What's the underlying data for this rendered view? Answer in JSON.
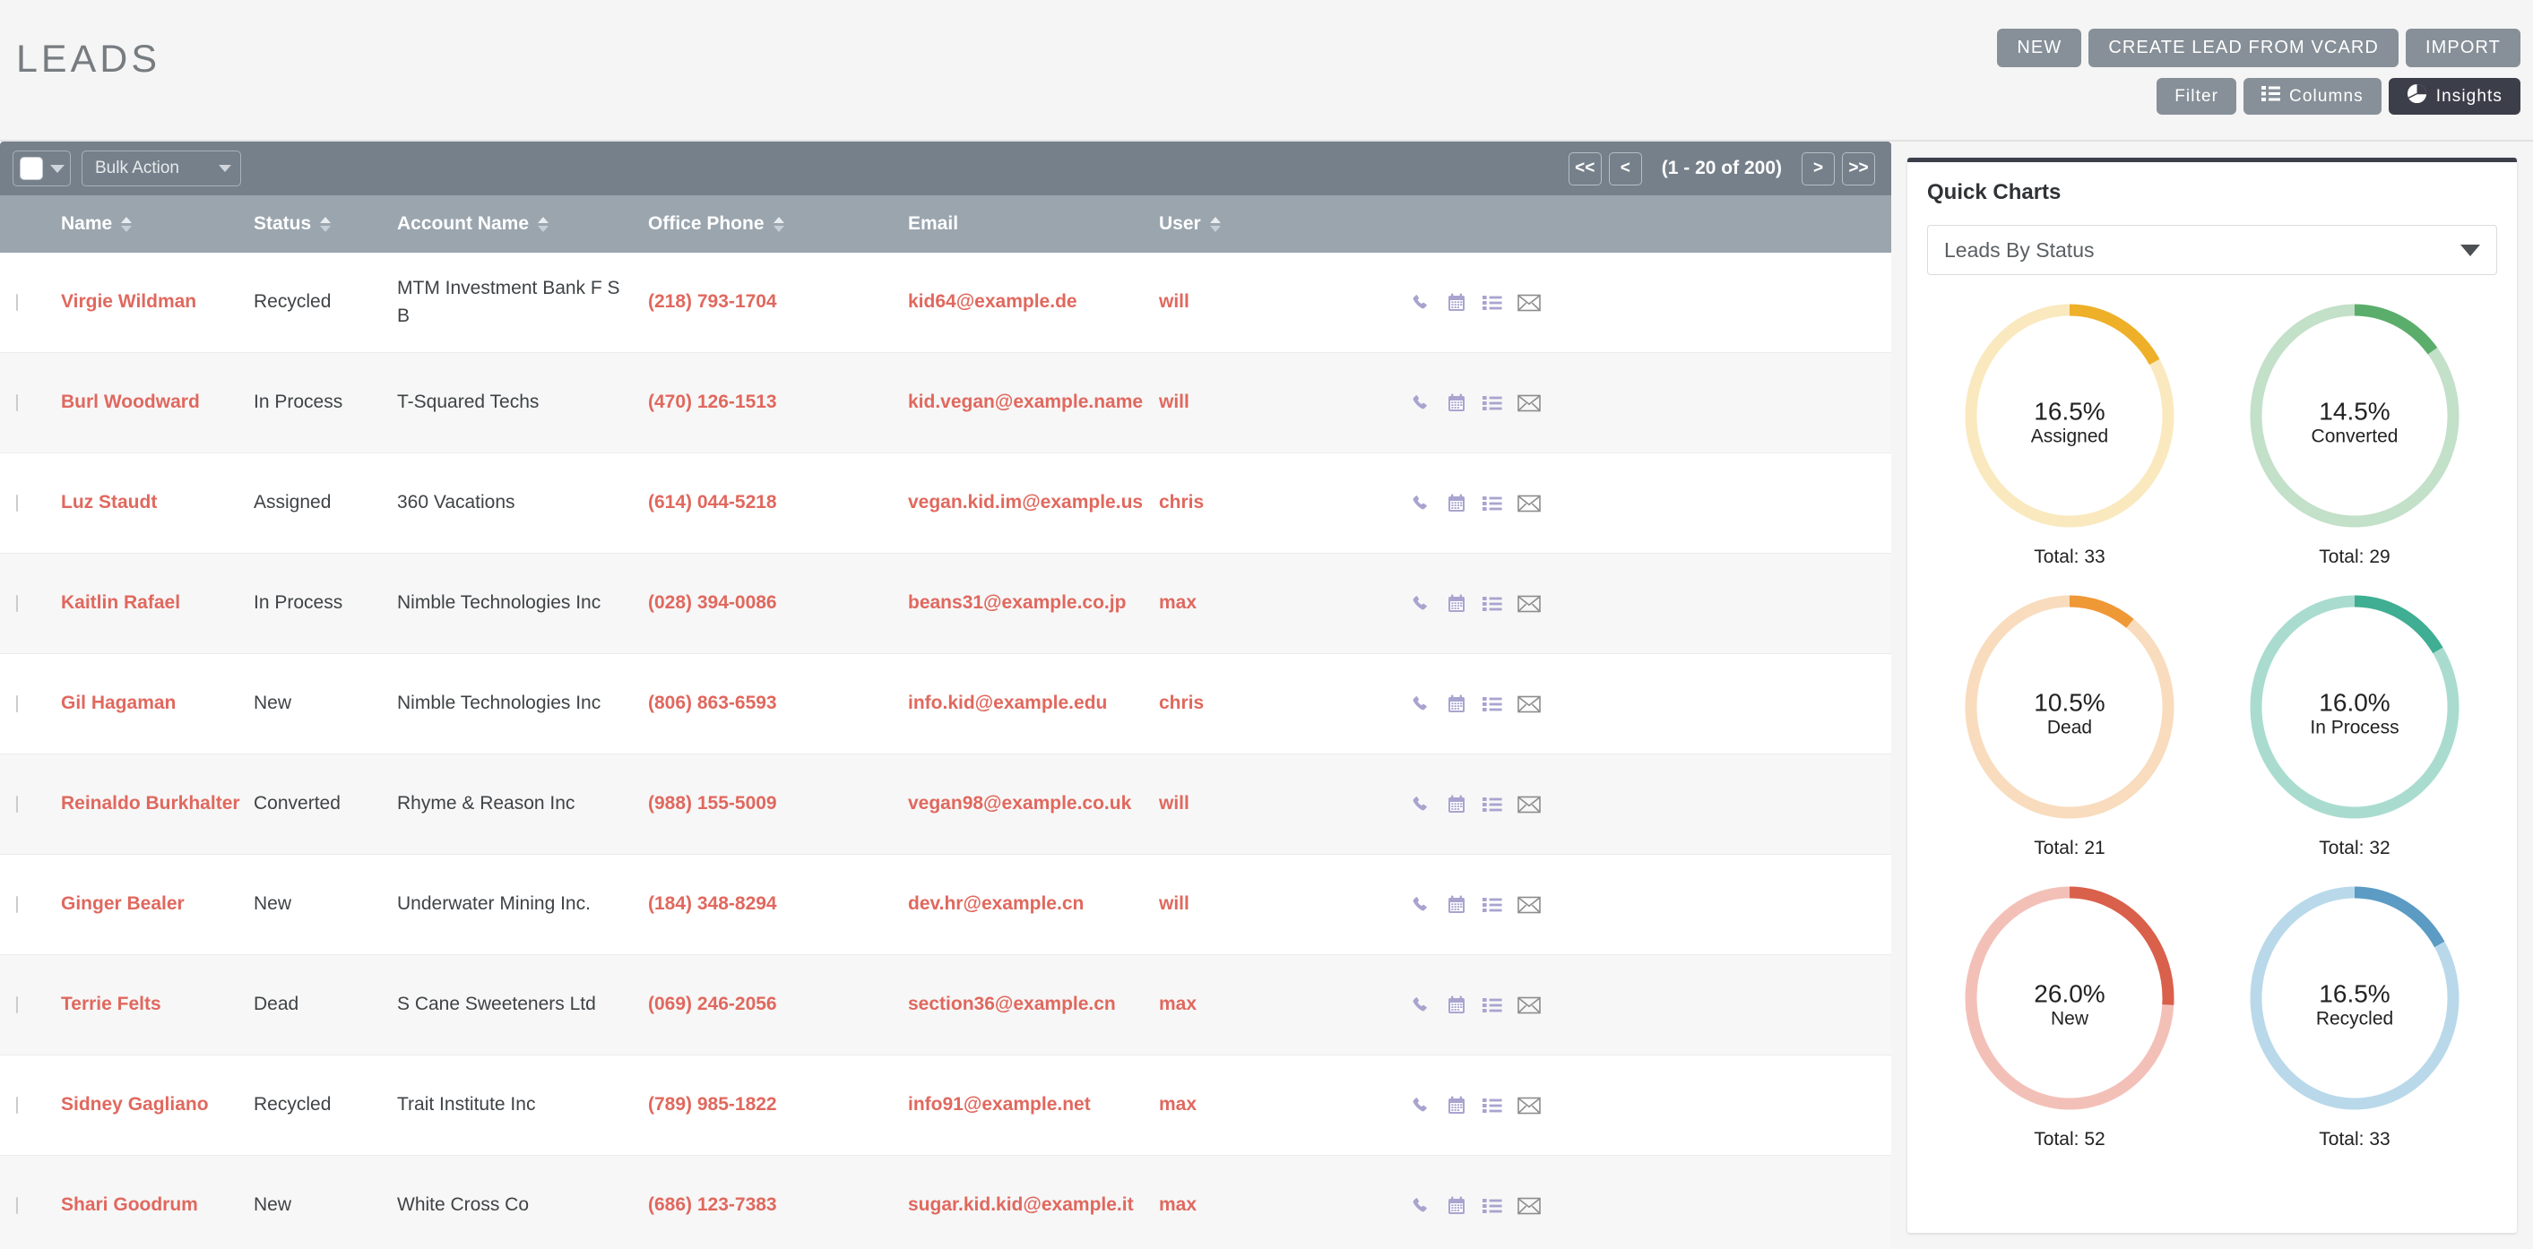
{
  "header": {
    "title": "LEADS",
    "actions_primary": [
      {
        "label": "NEW",
        "name": "new-button"
      },
      {
        "label": "CREATE LEAD FROM VCARD",
        "name": "create-lead-from-vcard-button"
      },
      {
        "label": "IMPORT",
        "name": "import-button"
      }
    ],
    "actions_secondary": [
      {
        "label": "Filter",
        "name": "filter-button",
        "icon": null,
        "style": "light"
      },
      {
        "label": "Columns",
        "name": "columns-button",
        "icon": "list-icon",
        "style": "light"
      },
      {
        "label": "Insights",
        "name": "insights-button",
        "icon": "pie-chart-icon",
        "style": "dark"
      }
    ]
  },
  "toolbar": {
    "bulk_action_label": "Bulk Action",
    "pagination": {
      "first_label": "<<",
      "prev_label": "<",
      "count_label": "(1 - 20 of 200)",
      "next_label": ">",
      "last_label": ">>"
    }
  },
  "table": {
    "columns": [
      {
        "label": "Name",
        "sortable": true
      },
      {
        "label": "Status",
        "sortable": true
      },
      {
        "label": "Account Name",
        "sortable": true
      },
      {
        "label": "Office Phone",
        "sortable": true
      },
      {
        "label": "Email",
        "sortable": false
      },
      {
        "label": "User",
        "sortable": true
      }
    ],
    "row_actions": [
      "phone-icon",
      "calendar-icon",
      "list-icon",
      "envelope-icon"
    ],
    "rows": [
      {
        "name": "Virgie Wildman",
        "status": "Recycled",
        "account": "MTM Investment Bank F S B",
        "phone": "(218) 793-1704",
        "email": "kid64@example.de",
        "user": "will"
      },
      {
        "name": "Burl Woodward",
        "status": "In Process",
        "account": "T-Squared Techs",
        "phone": "(470) 126-1513",
        "email": "kid.vegan@example.name",
        "user": "will"
      },
      {
        "name": "Luz Staudt",
        "status": "Assigned",
        "account": "360 Vacations",
        "phone": "(614) 044-5218",
        "email": "vegan.kid.im@example.us",
        "user": "chris"
      },
      {
        "name": "Kaitlin Rafael",
        "status": "In Process",
        "account": "Nimble Technologies Inc",
        "phone": "(028) 394-0086",
        "email": "beans31@example.co.jp",
        "user": "max"
      },
      {
        "name": "Gil Hagaman",
        "status": "New",
        "account": "Nimble Technologies Inc",
        "phone": "(806) 863-6593",
        "email": "info.kid@example.edu",
        "user": "chris"
      },
      {
        "name": "Reinaldo Burkhalter",
        "status": "Converted",
        "account": "Rhyme & Reason Inc",
        "phone": "(988) 155-5009",
        "email": "vegan98@example.co.uk",
        "user": "will"
      },
      {
        "name": "Ginger Bealer",
        "status": "New",
        "account": "Underwater Mining Inc.",
        "phone": "(184) 348-8294",
        "email": "dev.hr@example.cn",
        "user": "will"
      },
      {
        "name": "Terrie Felts",
        "status": "Dead",
        "account": "S Cane Sweeteners Ltd",
        "phone": "(069) 246-2056",
        "email": "section36@example.cn",
        "user": "max"
      },
      {
        "name": "Sidney Gagliano",
        "status": "Recycled",
        "account": "Trait Institute Inc",
        "phone": "(789) 985-1822",
        "email": "info91@example.net",
        "user": "max"
      },
      {
        "name": "Shari Goodrum",
        "status": "New",
        "account": "White Cross Co",
        "phone": "(686) 123-7383",
        "email": "sugar.kid.kid@example.it",
        "user": "max"
      }
    ]
  },
  "quick_charts": {
    "title": "Quick Charts",
    "selected_chart": "Leads By Status",
    "total_label_prefix": "Total: "
  },
  "chart_data": {
    "type": "pie",
    "title": "Leads By Status",
    "legend": "none",
    "segments": [
      {
        "label": "Assigned",
        "percent": 16.5,
        "percent_label": "16.5%",
        "total": 33,
        "total_label": "Total: 33",
        "color": "#eeb029",
        "track": "#fae9bf"
      },
      {
        "label": "Converted",
        "percent": 14.5,
        "percent_label": "14.5%",
        "total": 29,
        "total_label": "Total: 29",
        "color": "#5bad6b",
        "track": "#c3e0c8"
      },
      {
        "label": "Dead",
        "percent": 10.5,
        "percent_label": "10.5%",
        "total": 21,
        "total_label": "Total: 21",
        "color": "#ef9836",
        "track": "#f8dcbd"
      },
      {
        "label": "In Process",
        "percent": 16.0,
        "percent_label": "16.0%",
        "total": 32,
        "total_label": "Total: 32",
        "color": "#3fae92",
        "track": "#a9dccf"
      },
      {
        "label": "New",
        "percent": 26.0,
        "percent_label": "26.0%",
        "total": 52,
        "total_label": "Total: 52",
        "color": "#d9604b",
        "track": "#f3c0b8"
      },
      {
        "label": "Recycled",
        "percent": 16.5,
        "percent_label": "16.5%",
        "total": 33,
        "total_label": "Total: 33",
        "color": "#5b9bc4",
        "track": "#b9d9ea"
      }
    ]
  }
}
